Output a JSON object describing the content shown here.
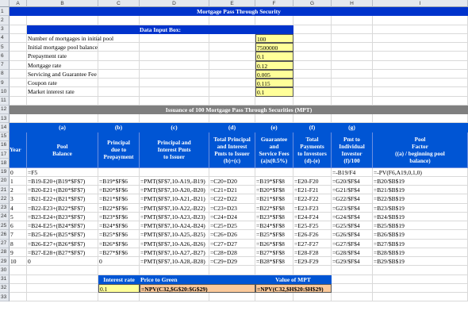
{
  "columns": [
    "A",
    "B",
    "C",
    "D",
    "E",
    "F",
    "G",
    "H",
    "I"
  ],
  "rows": [
    "1",
    "2",
    "3",
    "4",
    "5",
    "6",
    "7",
    "8",
    "9",
    "10",
    "11",
    "12",
    "13",
    "14",
    "15",
    "16",
    "17",
    "18",
    "19",
    "20",
    "21",
    "22",
    "23",
    "24",
    "25",
    "26",
    "27",
    "28",
    "29",
    "30",
    "31",
    "32",
    "33"
  ],
  "title": "Mortgage Pass Through Security",
  "input_box_title": "Data Input Box:",
  "inputs": [
    {
      "label": "Number of mortgages in initial pool",
      "value": "100"
    },
    {
      "label": "Initial mortgage pool balance",
      "value": "7500000"
    },
    {
      "label": "Prepayment rate",
      "value": "0.1"
    },
    {
      "label": "Mortgage rate",
      "value": "0.12"
    },
    {
      "label": "Servicing and Guarantee Fee",
      "value": "0.005"
    },
    {
      "label": "Coupon rate",
      "value": "0.115"
    },
    {
      "label": "Market interest rate",
      "value": "0.1"
    }
  ],
  "issuance_title": "Issuance of 100 Mortgage Pass Through Securities (MPT)",
  "letters": [
    "(a)",
    "(b)",
    "(c)",
    "(d)",
    "(e)",
    "(f)",
    "(g)"
  ],
  "headers": {
    "year": "Year",
    "a": "Pool\nBalance",
    "b": "Principal\ndue to\nPrepayment",
    "c": "Principal and\nInterest Pmts\nto Issuer",
    "d": "Total Principal\nand Interest\nPmts to Issuer\n(b)+(c)",
    "e": "Guarantee\nand\nService Fees\n(a)x(0.5%)",
    "f": "Total\nPayments\nto Investors\n(d)-(e)",
    "g": "Pmt to\nIndividual\nInvestor\n(f)/100",
    "h": "Pool\nFactor\n((a) / beginning pool\nbalance)"
  },
  "table": [
    {
      "row": "19",
      "year": "0",
      "a": "=F5",
      "b": "",
      "c": "",
      "d": "",
      "e": "",
      "f": "",
      "g": "=-B19/F4",
      "h": "=-PV(F6,A19,0,1,0)"
    },
    {
      "row": "20",
      "year": "1",
      "a": "=B19-E20+(B19*$F$7)",
      "b": "=B19*$F$6",
      "c": "=PMT($F$7,10-A19,-B19)",
      "d": "=C20+D20",
      "e": "=B19*$F$8",
      "f": "=E20-F20",
      "g": "=G20/$F$4",
      "h": "=B20/$B$19"
    },
    {
      "row": "21",
      "year": "2",
      "a": "=B20-E21+(B20*$F$7)",
      "b": "=B20*$F$6",
      "c": "=PMT($F$7,10-A20,-B20)",
      "d": "=C21+D21",
      "e": "=B20*$F$8",
      "f": "=E21-F21",
      "g": "=G21/$F$4",
      "h": "=B21/$B$19"
    },
    {
      "row": "22",
      "year": "3",
      "a": "=B21-E22+(B21*$F$7)",
      "b": "=B21*$F$6",
      "c": "=PMT($F$7,10-A21,-B21)",
      "d": "=C22+D22",
      "e": "=B21*$F$8",
      "f": "=E22-F22",
      "g": "=G22/$F$4",
      "h": "=B22/$B$19"
    },
    {
      "row": "23",
      "year": "4",
      "a": "=B22-E23+(B22*$F$7)",
      "b": "=B22*$F$6",
      "c": "=PMT($F$7,10-A22,-B22)",
      "d": "=C23+D23",
      "e": "=B22*$F$8",
      "f": "=E23-F23",
      "g": "=G23/$F$4",
      "h": "=B23/$B$19"
    },
    {
      "row": "24",
      "year": "5",
      "a": "=B23-E24+(B23*$F$7)",
      "b": "=B23*$F$6",
      "c": "=PMT($F$7,10-A23,-B23)",
      "d": "=C24+D24",
      "e": "=B23*$F$8",
      "f": "=E24-F24",
      "g": "=G24/$F$4",
      "h": "=B24/$B$19"
    },
    {
      "row": "25",
      "year": "6",
      "a": "=B24-E25+(B24*$F$7)",
      "b": "=B24*$F$6",
      "c": "=PMT($F$7,10-A24,-B24)",
      "d": "=C25+D25",
      "e": "=B24*$F$8",
      "f": "=E25-F25",
      "g": "=G25/$F$4",
      "h": "=B25/$B$19"
    },
    {
      "row": "26",
      "year": "7",
      "a": "=B25-E26+(B25*$F$7)",
      "b": "=B25*$F$6",
      "c": "=PMT($F$7,10-A25,-B25)",
      "d": "=C26+D26",
      "e": "=B25*$F$8",
      "f": "=E26-F26",
      "g": "=G26/$F$4",
      "h": "=B26/$B$19"
    },
    {
      "row": "27",
      "year": "8",
      "a": "=B26-E27+(B26*$F$7)",
      "b": "=B26*$F$6",
      "c": "=PMT($F$7,10-A26,-B26)",
      "d": "=C27+D27",
      "e": "=B26*$F$8",
      "f": "=E27-F27",
      "g": "=G27/$F$4",
      "h": "=B27/$B$19"
    },
    {
      "row": "28",
      "year": "9",
      "a": "=B27-E28+(B27*$F$7)",
      "b": "=B27*$F$6",
      "c": "=PMT($F$7,10-A27,-B27)",
      "d": "=C28+D28",
      "e": "=B27*$F$8",
      "f": "=E28-F28",
      "g": "=G28/$F$4",
      "h": "=B28/$B$19"
    },
    {
      "row": "29",
      "year": "10",
      "a": "0",
      "b": "0",
      "c": "=PMT($F$7,10-A28,-B28)",
      "d": "=C29+D29",
      "e": "=B28*$F$8",
      "f": "=E29-F29",
      "g": "=G29/$F$4",
      "h": "=B29/$B$19"
    }
  ],
  "footer": {
    "interest_rate_label": "Interest rate",
    "price_to_green_label": "Price to Green",
    "value_of_mpt_label": "Value of MPT",
    "interest_rate_value": "0.1",
    "price_to_green_formula": "=NPV(C32,$G$20:$G$29)",
    "value_of_mpt_formula": "=NPV(C32,$H$20:$H$29)"
  },
  "colors": {
    "title_blue": "#0033cc",
    "header_blue": "#0055d4",
    "gray_band": "#7f7f7f",
    "input_yellow": "#ffff99",
    "peach": "#fbc99a"
  }
}
